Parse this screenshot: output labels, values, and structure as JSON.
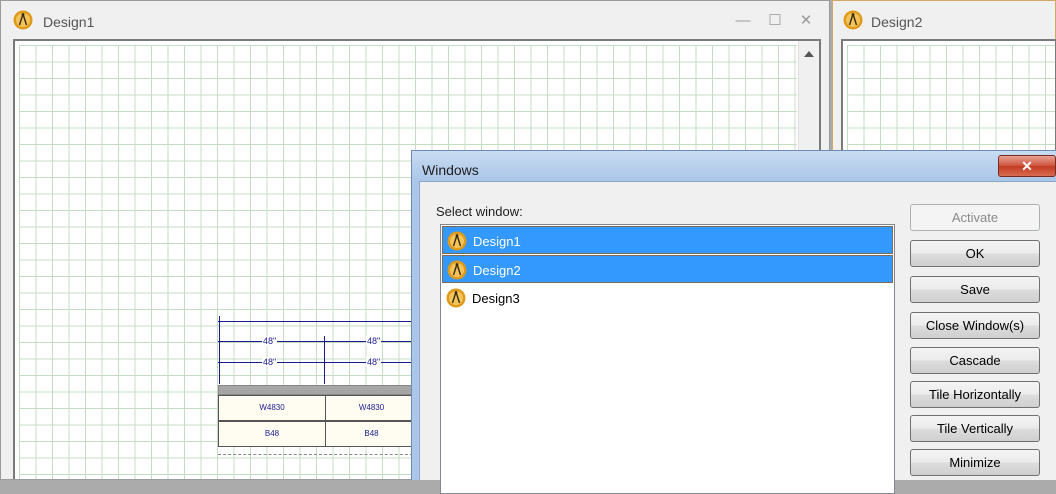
{
  "mdi": {
    "window1": {
      "title": "Design1",
      "controls": {
        "minimize": "—",
        "maximize": "☐",
        "close": "✕"
      }
    },
    "window2": {
      "title": "Design2"
    }
  },
  "drawing": {
    "dimensions": [
      "48\"",
      "48\"",
      "48\"",
      "48\""
    ],
    "cabinets": {
      "upper": [
        "W4830",
        "W4830"
      ],
      "lower": [
        "B48",
        "B48"
      ]
    }
  },
  "dialog": {
    "title": "Windows",
    "close_glyph": "✕",
    "select_label": "Select window:",
    "items": [
      {
        "label": "Design1",
        "selected": true
      },
      {
        "label": "Design2",
        "selected": true
      },
      {
        "label": "Design3",
        "selected": false
      }
    ],
    "buttons": {
      "activate": "Activate",
      "ok": "OK",
      "save": "Save",
      "close_windows": "Close Window(s)",
      "cascade": "Cascade",
      "tile_horizontally": "Tile Horizontally",
      "tile_vertically": "Tile Vertically",
      "minimize": "Minimize"
    }
  },
  "colors": {
    "selection": "#3399ff",
    "grid": "#c4dcc4",
    "drawing_ink": "#1a1a8c",
    "dialog_frame": "#aac6e8",
    "close_button": "#c23a22"
  },
  "icons": [
    "compass-app-icon",
    "minimize-icon",
    "maximize-icon",
    "close-icon",
    "scroll-up-arrow-icon"
  ]
}
